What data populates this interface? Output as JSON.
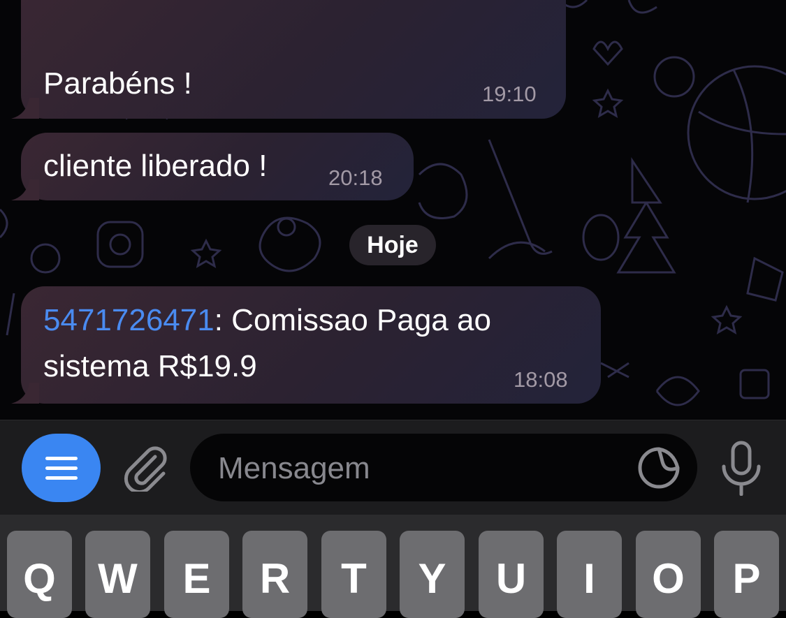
{
  "messages": [
    {
      "text": "Parabéns !",
      "time": "19:10"
    },
    {
      "text": "cliente liberado !",
      "time": "20:18"
    },
    {
      "sender": "5471726471",
      "text": ": Comissao Paga ao\nsistema R$19.9",
      "time": "18:08"
    }
  ],
  "date_separator": "Hoje",
  "composer": {
    "placeholder": "Mensagem"
  },
  "keyboard": {
    "keys": [
      "Q",
      "W",
      "E",
      "R",
      "T",
      "Y",
      "U",
      "I",
      "O",
      "P"
    ]
  },
  "icons": {
    "menu": "menu-icon",
    "attach": "paperclip-icon",
    "sticker": "sticker-icon",
    "mic": "microphone-icon"
  },
  "colors": {
    "accent": "#3a86f2",
    "sender": "#4a8bf0"
  }
}
